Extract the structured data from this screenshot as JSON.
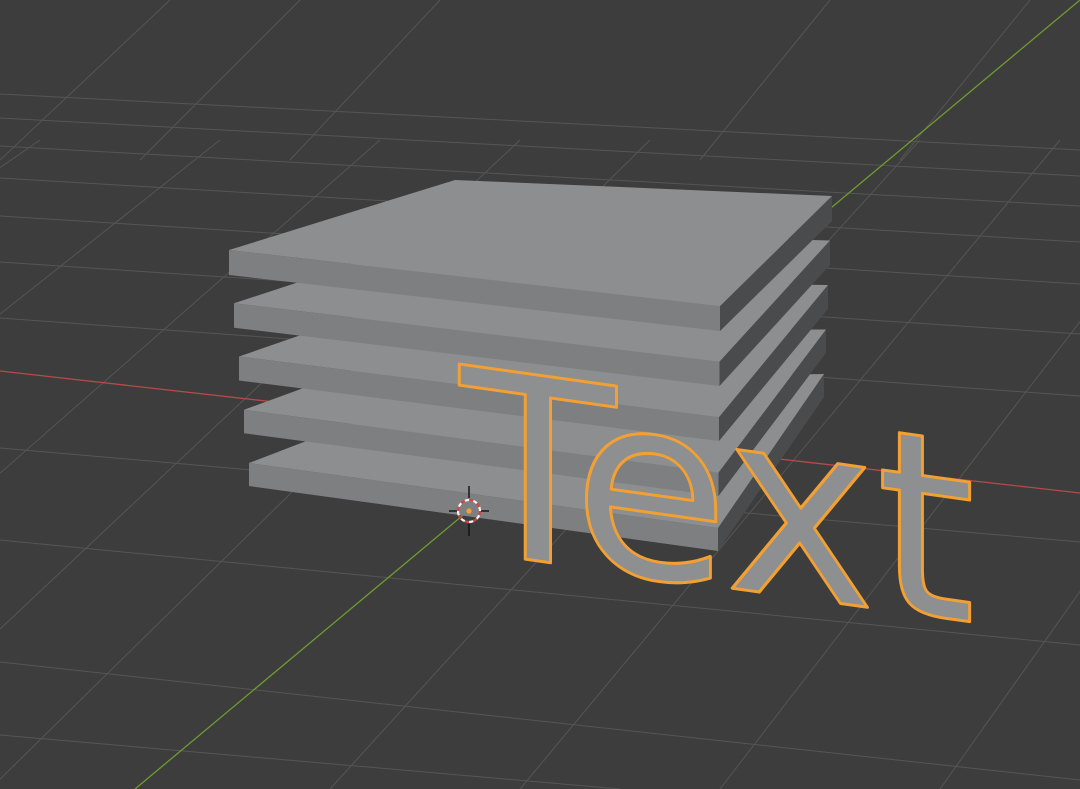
{
  "viewport": {
    "background_color": "#3d3d3d",
    "grid_color": "#555555",
    "x_axis_color": "#b64a4a",
    "y_axis_color": "#6f9a2f"
  },
  "objects": {
    "stack": {
      "slab_count": 5,
      "top_face_color": "#8c8e8f",
      "front_face_color": "#7d7f80",
      "side_face_color": "#4a4b4c"
    },
    "text_object": {
      "content": "Text",
      "fill_color": "#8d8f90",
      "selection_outline_color": "#f2a033"
    }
  },
  "scene_origin": {
    "icon": "3d-cursor-icon",
    "ring_colors": [
      "#d84040",
      "#f2f2f2"
    ]
  }
}
